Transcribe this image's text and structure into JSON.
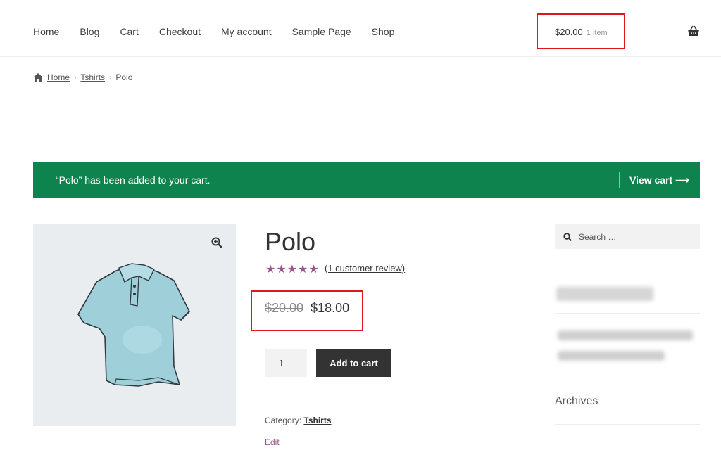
{
  "nav": {
    "items": [
      "Home",
      "Blog",
      "Cart",
      "Checkout",
      "My account",
      "Sample Page",
      "Shop"
    ]
  },
  "cart_summary": {
    "total": "$20.00",
    "count": "1 item"
  },
  "breadcrumb": {
    "home": "Home",
    "category": "Tshirts",
    "current": "Polo"
  },
  "notice": {
    "message": "“Polo” has been added to your cart.",
    "action": "View cart ⟶"
  },
  "product": {
    "title": "Polo",
    "stars": "★★★★★",
    "rating": 5,
    "review_link": "(1 customer review)",
    "old_price": "$20.00",
    "price": "$18.00",
    "quantity": "1",
    "add_to_cart": "Add to cart",
    "category_label": "Category:",
    "category": "Tshirts",
    "edit": "Edit"
  },
  "sidebar": {
    "search_placeholder": "Search …",
    "archives_title": "Archives"
  },
  "colors": {
    "notice_bg": "#0f834d",
    "star": "#96588a",
    "highlight": "#e0161f",
    "button_bg": "#333333"
  }
}
